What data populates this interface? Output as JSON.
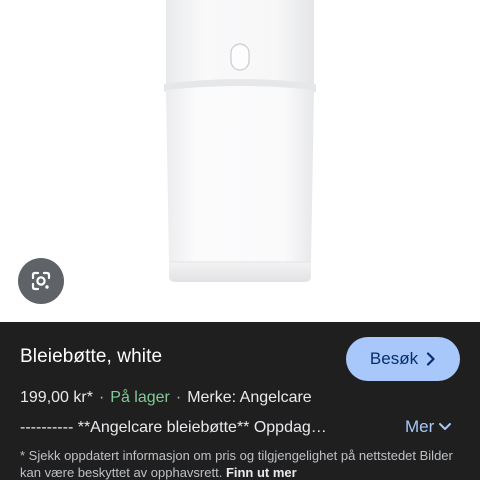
{
  "product": {
    "title": "Bleiebøtte, white",
    "price": "199,00 kr*",
    "stock": "På lager",
    "brand": "Merke: Angelcare",
    "description": "---------- **Angelcare bleiebøtte** Oppdag…"
  },
  "actions": {
    "visit_label": "Besøk",
    "more_label": "Mer"
  },
  "disclaimer": {
    "text": "* Sjekk oppdatert informasjon om pris og tilgjengelighet på nettstedet Bilder kan være beskyttet av opphavsrett. ",
    "link_label": "Finn ut mer"
  },
  "icons": {
    "lens": "google-lens-icon",
    "visit_chevron": "chevron-right-icon",
    "more_chevron": "chevron-down-icon"
  },
  "colors": {
    "panel_bg": "#1f1f20",
    "accent_button": "#a8c7fa",
    "in_stock": "#81c995",
    "link": "#a8c7fa"
  }
}
